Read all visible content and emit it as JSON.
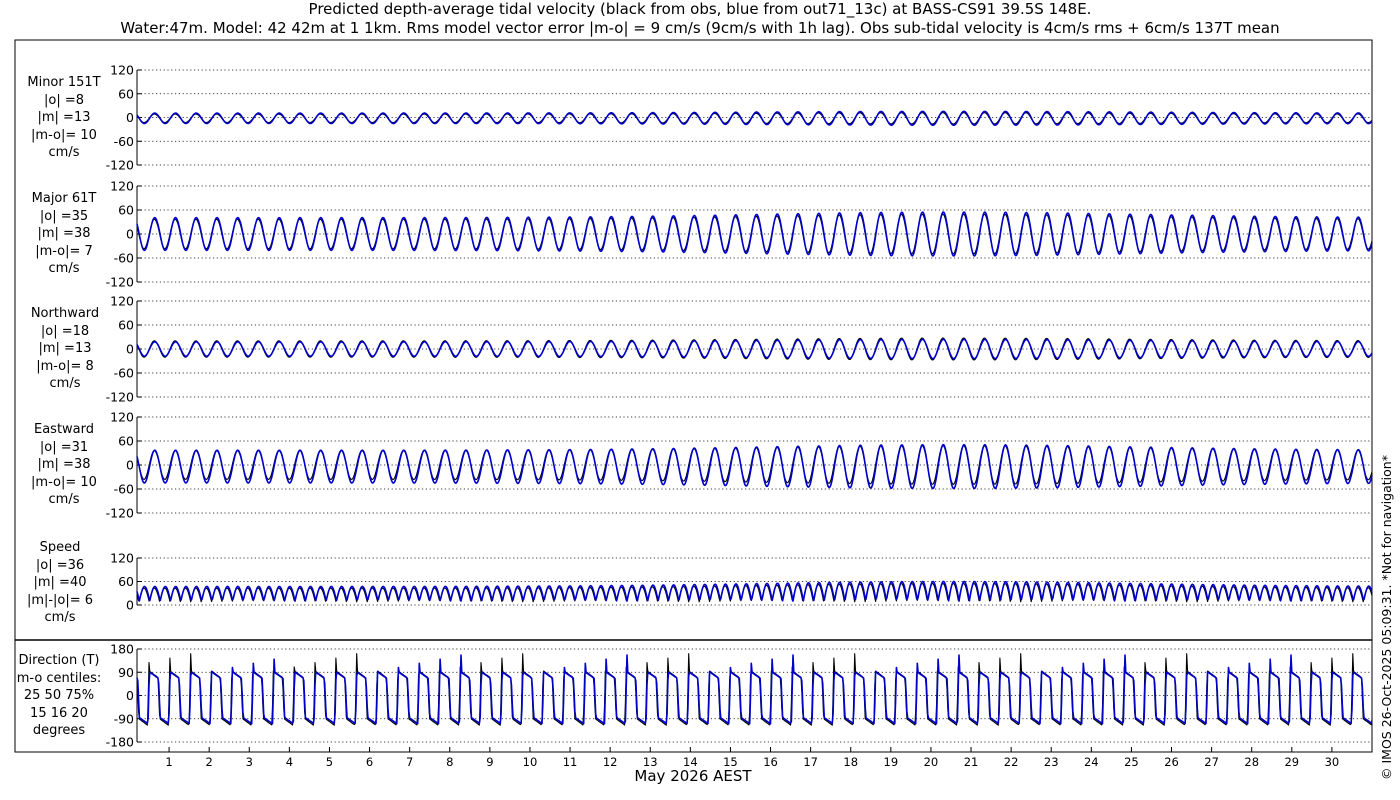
{
  "title_line1": "Predicted depth-average tidal velocity (black from obs, blue from out71_13c) at BASS-CS91 39.5S 148E.",
  "title_line2": "Water:47m. Model: 42 42m at 1 1km. Rms model vector error |m-o| = 9 cm/s (9cm/s with 1h lag). Obs sub-tidal velocity is 4cm/s rms + 6cm/s 137T mean",
  "side_note": "© IMOS 26-Oct-2025 05:09:31. *Not for navigation*",
  "colors": {
    "obs": "#000000",
    "model": "#0000cc",
    "grid": "#000000",
    "frame": "#000000"
  },
  "chart_data": [
    {
      "type": "line",
      "name": "minor",
      "label_lines": [
        "Minor 151T",
        "|o| =8",
        "|m| =13",
        "|m-o|= 10",
        "cm/s"
      ],
      "ylim": [
        -120,
        120
      ],
      "yticks": [
        -120,
        -60,
        0,
        60,
        120
      ],
      "tick_labels": [
        "-120",
        "-60",
        "0",
        "60",
        "120"
      ],
      "obs_amplitude": 13,
      "model_amplitude": 16,
      "obs_offset": -2,
      "model_offset": -2,
      "series": [
        {
          "name": "obs"
        },
        {
          "name": "model"
        }
      ]
    },
    {
      "type": "line",
      "name": "major",
      "label_lines": [
        "Major 61T",
        "|o| =35",
        "|m| =38",
        "|m-o|= 7",
        "cm/s"
      ],
      "ylim": [
        -120,
        120
      ],
      "yticks": [
        -120,
        -60,
        0,
        60,
        120
      ],
      "tick_labels": [
        "-120",
        "-60",
        "0",
        "60",
        "120"
      ],
      "obs_amplitude": 45,
      "model_amplitude": 50,
      "obs_offset": 0,
      "model_offset": 0,
      "series": [
        {
          "name": "obs"
        },
        {
          "name": "model"
        }
      ]
    },
    {
      "type": "line",
      "name": "northward",
      "label_lines": [
        "Northward",
        "|o| =18",
        "|m| =13",
        "|m-o|= 8",
        "cm/s"
      ],
      "ylim": [
        -120,
        120
      ],
      "yticks": [
        -120,
        -60,
        0,
        60,
        120
      ],
      "tick_labels": [
        "-120",
        "-60",
        "0",
        "60",
        "120"
      ],
      "obs_amplitude": 25,
      "model_amplitude": 22,
      "obs_offset": 0,
      "model_offset": 0,
      "series": [
        {
          "name": "obs"
        },
        {
          "name": "model"
        }
      ]
    },
    {
      "type": "line",
      "name": "eastward",
      "label_lines": [
        "Eastward",
        "|o| =31",
        "|m| =38",
        "|m-o|= 10",
        "cm/s"
      ],
      "ylim": [
        -120,
        120
      ],
      "yticks": [
        -120,
        -60,
        0,
        60,
        120
      ],
      "tick_labels": [
        "-120",
        "-60",
        "0",
        "60",
        "120"
      ],
      "obs_amplitude": 44,
      "model_amplitude": 50,
      "obs_offset": 0,
      "model_offset": -4,
      "series": [
        {
          "name": "obs"
        },
        {
          "name": "model"
        }
      ]
    },
    {
      "type": "line",
      "name": "speed",
      "label_lines": [
        "Speed",
        "|o| =36",
        "|m| =40",
        "|m|-|o|= 6",
        "cm/s"
      ],
      "ylim": [
        0,
        120
      ],
      "yticks": [
        0,
        60,
        120
      ],
      "tick_labels": [
        "0",
        "60",
        "120"
      ],
      "obs_amplitude": 45,
      "model_amplitude": 48,
      "series": [
        {
          "name": "obs"
        },
        {
          "name": "model"
        }
      ]
    },
    {
      "type": "line",
      "name": "direction",
      "label_lines": [
        "Direction (T)",
        "m-o centiles:",
        "25  50  75%",
        "15  16  20",
        "degrees"
      ],
      "ylim": [
        -180,
        180
      ],
      "yticks": [
        -180,
        -90,
        0,
        90,
        180
      ],
      "tick_labels": [
        "-180",
        "-90",
        "0",
        "90",
        "180"
      ],
      "series": [
        {
          "name": "obs"
        },
        {
          "name": "model"
        }
      ]
    }
  ],
  "x_axis": {
    "label": "May 2026 AEST",
    "day_range": [
      0.2,
      31
    ],
    "ticks": [
      1,
      2,
      3,
      4,
      5,
      6,
      7,
      8,
      9,
      10,
      11,
      12,
      13,
      14,
      15,
      16,
      17,
      18,
      19,
      20,
      21,
      22,
      23,
      24,
      25,
      26,
      27,
      28,
      29,
      30
    ],
    "tick_labels": [
      "1",
      "2",
      "3",
      "4",
      "5",
      "6",
      "7",
      "8",
      "9",
      "10",
      "11",
      "12",
      "13",
      "14",
      "15",
      "16",
      "17",
      "18",
      "19",
      "20",
      "21",
      "22",
      "23",
      "24",
      "25",
      "26",
      "27",
      "28",
      "29",
      "30"
    ]
  },
  "tide": {
    "period_hours": 12.42,
    "spring_peak_day": 20.5
  }
}
